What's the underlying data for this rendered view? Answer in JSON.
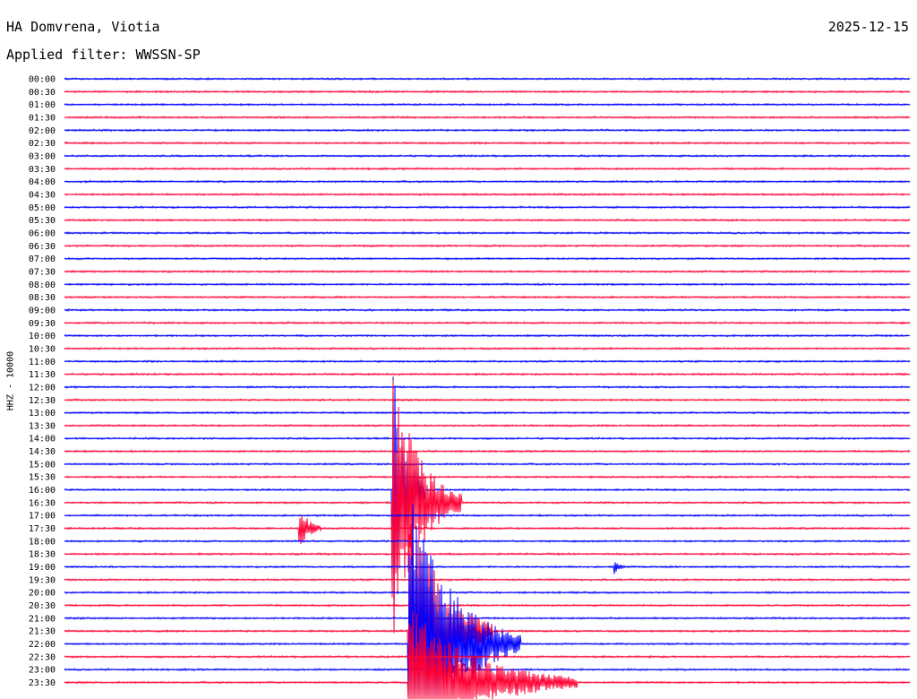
{
  "header": {
    "station": "HA Domvrena, Viotia",
    "date": "2025-12-15",
    "filter": "Applied filter: WWSSN-SP"
  },
  "chart_data": {
    "type": "line",
    "title": "HA Domvrena, Viotia",
    "ylabel": "HHZ - 10000",
    "colors": [
      "#0000ff",
      "#ff0033"
    ],
    "row_labels": [
      "00:00",
      "00:30",
      "01:00",
      "01:30",
      "02:00",
      "02:30",
      "03:00",
      "03:30",
      "04:00",
      "04:30",
      "05:00",
      "05:30",
      "06:00",
      "06:30",
      "07:00",
      "07:30",
      "08:00",
      "08:30",
      "09:00",
      "09:30",
      "10:00",
      "10:30",
      "11:00",
      "11:30",
      "12:00",
      "12:30",
      "13:00",
      "13:30",
      "14:00",
      "14:30",
      "15:00",
      "15:30",
      "16:00",
      "16:30",
      "17:00",
      "17:30",
      "18:00",
      "18:30",
      "19:00",
      "19:30",
      "20:00",
      "20:30",
      "21:00",
      "21:30",
      "22:00",
      "22:30",
      "23:00",
      "23:30"
    ],
    "trace_span_minutes": 30,
    "events": [
      {
        "trace": "16:00",
        "minute": 11.6,
        "amplitude": 10,
        "duration_minutes": 1.2
      },
      {
        "trace": "16:30",
        "minute": 11.6,
        "amplitude": 9,
        "duration_minutes": 2.5
      },
      {
        "trace": "17:30",
        "minute": 8.3,
        "amplitude": 1.8,
        "duration_minutes": 0.8
      },
      {
        "trace": "19:00",
        "minute": 19.5,
        "amplitude": 0.5,
        "duration_minutes": 0.4
      },
      {
        "trace": "21:30",
        "minute": 12.2,
        "amplitude": 9,
        "duration_minutes": 3
      },
      {
        "trace": "22:00",
        "minute": 12.2,
        "amplitude": 10,
        "duration_minutes": 4
      },
      {
        "trace": "23:30",
        "minute": 12.2,
        "amplitude": 5,
        "duration_minutes": 6
      }
    ]
  }
}
